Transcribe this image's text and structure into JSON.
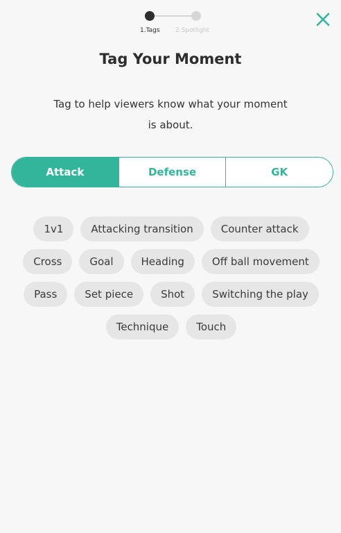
{
  "stepper": {
    "steps": [
      {
        "label": "1.Tags"
      },
      {
        "label": "2.Spotlight"
      }
    ]
  },
  "header": {
    "close_icon": "close-icon"
  },
  "title": "Tag Your Moment",
  "subtitle": "Tag to help viewers know what your moment is about.",
  "tabs": [
    {
      "label": "Attack",
      "selected": true
    },
    {
      "label": "Defense",
      "selected": false
    },
    {
      "label": "GK",
      "selected": false
    }
  ],
  "tags": [
    "1v1",
    "Attacking transition",
    "Counter attack",
    "Cross",
    "Goal",
    "Heading",
    "Off ball movement",
    "Pass",
    "Set piece",
    "Shot",
    "Switching the play",
    "Technique",
    "Touch"
  ],
  "colors": {
    "accent": "#32b59b",
    "background": "#f7f7f7",
    "chip": "#e6e6e6",
    "step_active": "#2e2e2e",
    "step_inactive": "#d6d6d6"
  }
}
